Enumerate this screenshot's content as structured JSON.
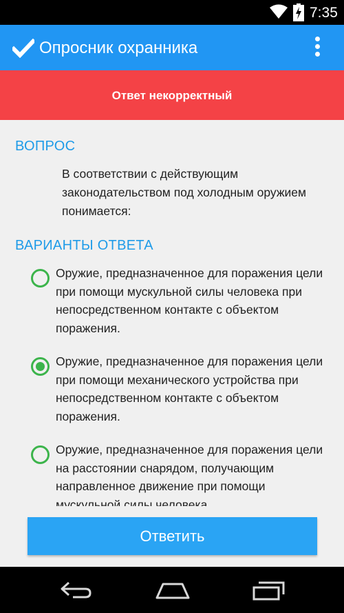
{
  "status_bar": {
    "time": "7:35",
    "wifi_icon": "wifi-icon",
    "battery_icon": "battery-charging-icon"
  },
  "app_bar": {
    "title": "Опросник охранника",
    "nav_icon": "check-icon",
    "menu_icon": "more-vert-icon",
    "color": "#2196f3"
  },
  "banner": {
    "text": "Ответ некорректный",
    "color": "#f44246"
  },
  "question": {
    "heading": "ВОПРОС",
    "text": "В соответствии с действующим законодательством под холодным оружием понимается:"
  },
  "answers": {
    "heading": "ВАРИАНТЫ ОТВЕТА",
    "options": [
      {
        "text": "Оружие, предназначенное для поражения цели при помощи мускульной силы человека при непосредственном контакте с объектом поражения.",
        "selected": false
      },
      {
        "text": "Оружие, предназначенное для поражения цели при помощи механического устройства при непосредственном контакте с объектом поражения.",
        "selected": true
      },
      {
        "text": "Оружие, предназначенное для поражения цели на расстоянии снарядом, получающим направленное движение при помощи мускульной силы человека",
        "selected": false
      }
    ],
    "radio_color": "#3cb44b"
  },
  "submit": {
    "label": "Ответить",
    "color": "#2aa4f4"
  },
  "nav_bar": {
    "back_icon": "back-icon",
    "home_icon": "home-icon",
    "recents_icon": "recents-icon"
  }
}
